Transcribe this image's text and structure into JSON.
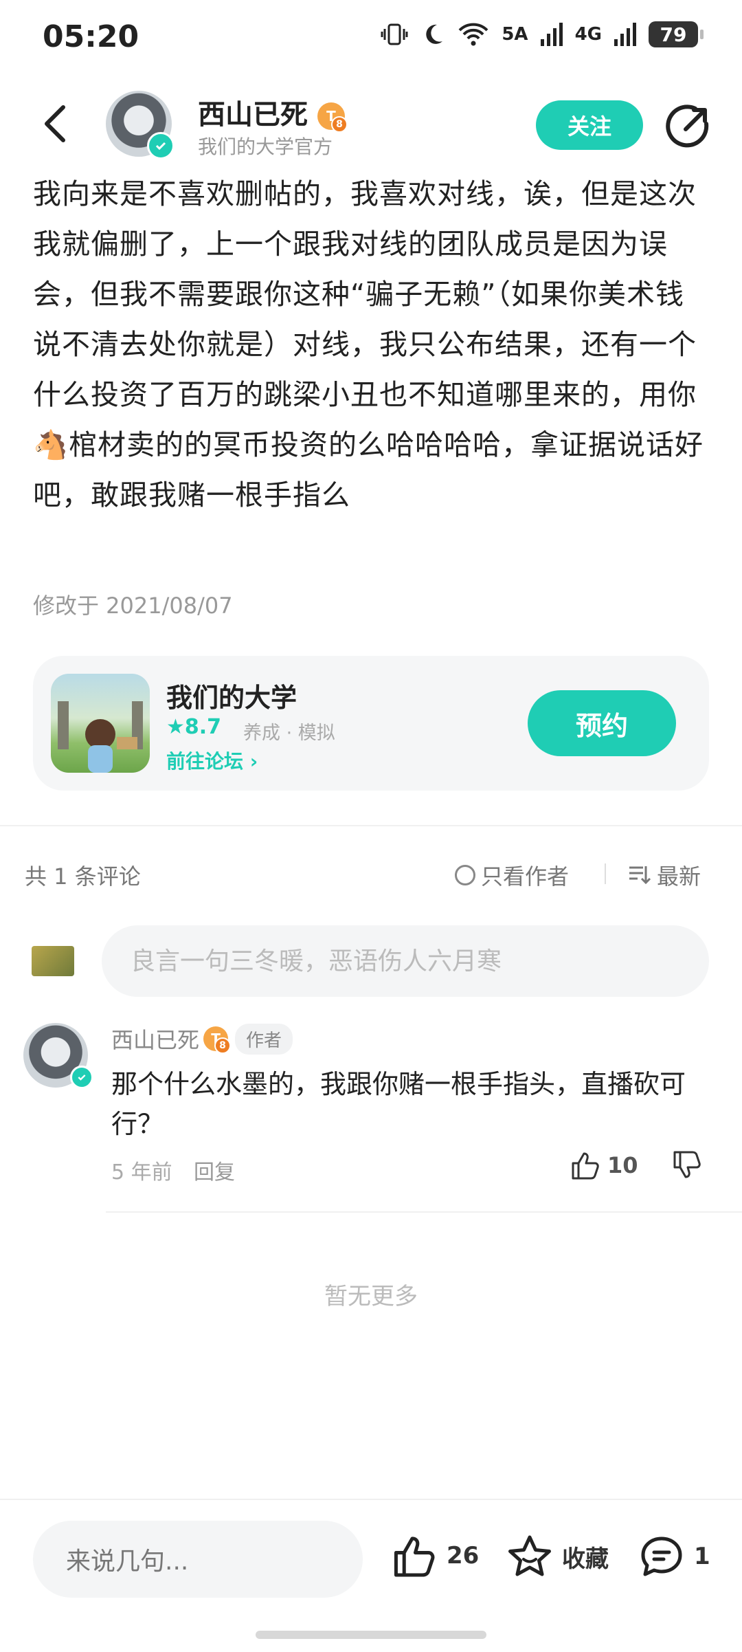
{
  "status_bar": {
    "time": "05:20",
    "network_5g": "5A",
    "network_4g": "4G",
    "battery": "79"
  },
  "header": {
    "author_name": "西山已死",
    "author_level": "8",
    "author_subtitle": "我们的大学官方",
    "follow_label": "关注"
  },
  "post": {
    "body_part1": "我向来是不喜欢删帖的，我喜欢对线，诶，但是这次我就偏删了，上一个跟我对线的团队成员是因为误会，但我不需要跟你这种“骗子无赖”（如果你美术钱说不清去处你就是）对线，我只公布结果，还有一个什么投资了百万的跳梁小丑也不知道哪里来的，用你",
    "body_emoji": "🐴",
    "body_part2": "棺材卖的的冥币投资的么哈哈哈哈，拿证据说话好吧，敢跟我赌一根手指么",
    "edit_time": "修改于 2021/08/07"
  },
  "game_card": {
    "name": "我们的大学",
    "rating": "8.7",
    "tags": "养成 · 模拟",
    "forum_link": "前往论坛",
    "reserve_label": "预约"
  },
  "comments_header": {
    "count_text": "共 1 条评论",
    "author_only": "只看作者",
    "sort_label": "最新"
  },
  "comment_input": {
    "placeholder": "良言一句三冬暖，恶语伤人六月寒"
  },
  "comments": [
    {
      "name": "西山已死",
      "level": "8",
      "tag": "作者",
      "text": "那个什么水墨的，我跟你赌一根手指头，直播砍可行？",
      "time": "5 年前",
      "reply_label": "回复",
      "likes": "10"
    }
  ],
  "no_more_text": "暂无更多",
  "bottom_bar": {
    "input_placeholder": "来说几句...",
    "likes": "26",
    "favorite_label": "收藏",
    "comment_count": "1"
  },
  "colors": {
    "accent": "#1fcdb4",
    "level_badge": "#f6a545"
  }
}
